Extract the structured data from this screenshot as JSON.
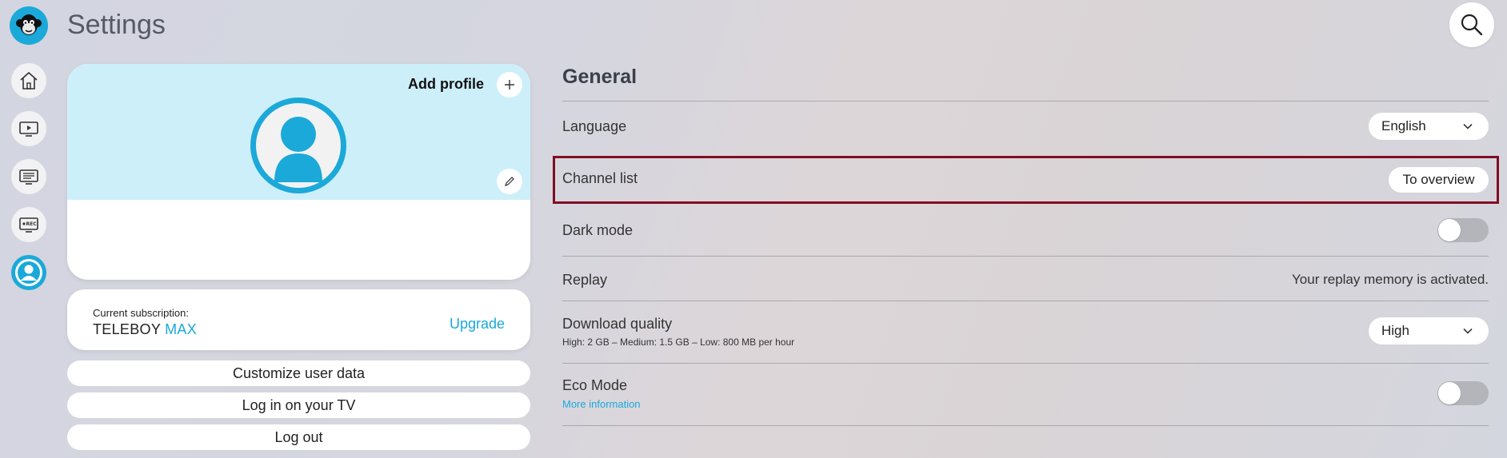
{
  "app": {
    "title": "Settings"
  },
  "sidebar": {
    "items": [
      {
        "name": "home"
      },
      {
        "name": "tv"
      },
      {
        "name": "guide"
      },
      {
        "name": "recordings"
      },
      {
        "name": "profile"
      }
    ]
  },
  "profile_card": {
    "add_profile_label": "Add profile",
    "bg_color": "#cdeffa"
  },
  "subscription": {
    "label": "Current subscription:",
    "plan_base": "TELEBOY",
    "plan_tier": "MAX",
    "upgrade_label": "Upgrade"
  },
  "account_actions": {
    "customize": "Customize user data",
    "tv_login": "Log in on your TV",
    "logout": "Log out"
  },
  "general": {
    "title": "General",
    "language": {
      "label": "Language",
      "value": "English"
    },
    "channel_list": {
      "label": "Channel list",
      "button": "To overview"
    },
    "dark_mode": {
      "label": "Dark mode",
      "enabled": false
    },
    "replay": {
      "label": "Replay",
      "status": "Your replay memory is activated."
    },
    "download_quality": {
      "label": "Download quality",
      "description": "High: 2 GB – Medium: 1.5 GB – Low: 800 MB per hour",
      "value": "High"
    },
    "eco_mode": {
      "label": "Eco Mode",
      "link": "More information",
      "enabled": false
    }
  },
  "colors": {
    "accent": "#1ba9d9",
    "highlight": "#820d22"
  }
}
